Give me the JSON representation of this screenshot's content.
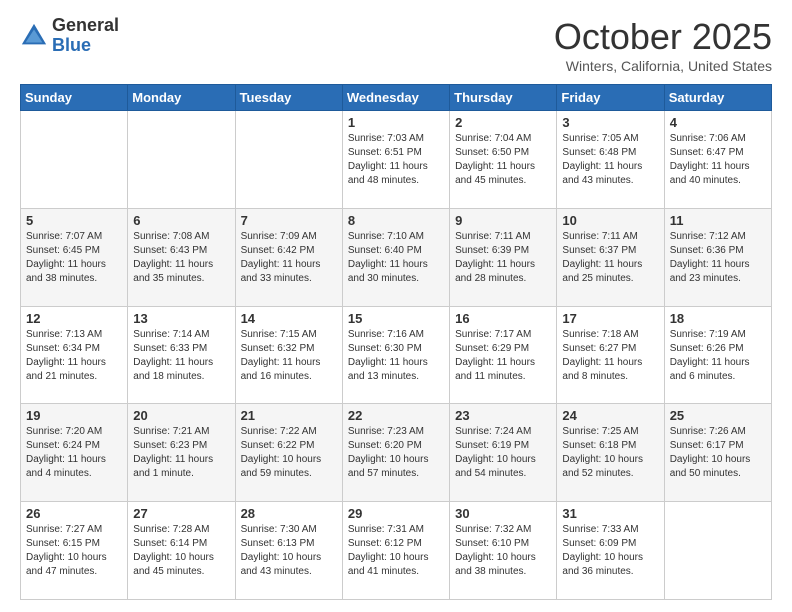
{
  "header": {
    "logo_general": "General",
    "logo_blue": "Blue",
    "month": "October 2025",
    "location": "Winters, California, United States"
  },
  "days_of_week": [
    "Sunday",
    "Monday",
    "Tuesday",
    "Wednesday",
    "Thursday",
    "Friday",
    "Saturday"
  ],
  "weeks": [
    [
      {
        "day": "",
        "info": ""
      },
      {
        "day": "",
        "info": ""
      },
      {
        "day": "",
        "info": ""
      },
      {
        "day": "1",
        "info": "Sunrise: 7:03 AM\nSunset: 6:51 PM\nDaylight: 11 hours and 48 minutes."
      },
      {
        "day": "2",
        "info": "Sunrise: 7:04 AM\nSunset: 6:50 PM\nDaylight: 11 hours and 45 minutes."
      },
      {
        "day": "3",
        "info": "Sunrise: 7:05 AM\nSunset: 6:48 PM\nDaylight: 11 hours and 43 minutes."
      },
      {
        "day": "4",
        "info": "Sunrise: 7:06 AM\nSunset: 6:47 PM\nDaylight: 11 hours and 40 minutes."
      }
    ],
    [
      {
        "day": "5",
        "info": "Sunrise: 7:07 AM\nSunset: 6:45 PM\nDaylight: 11 hours and 38 minutes."
      },
      {
        "day": "6",
        "info": "Sunrise: 7:08 AM\nSunset: 6:43 PM\nDaylight: 11 hours and 35 minutes."
      },
      {
        "day": "7",
        "info": "Sunrise: 7:09 AM\nSunset: 6:42 PM\nDaylight: 11 hours and 33 minutes."
      },
      {
        "day": "8",
        "info": "Sunrise: 7:10 AM\nSunset: 6:40 PM\nDaylight: 11 hours and 30 minutes."
      },
      {
        "day": "9",
        "info": "Sunrise: 7:11 AM\nSunset: 6:39 PM\nDaylight: 11 hours and 28 minutes."
      },
      {
        "day": "10",
        "info": "Sunrise: 7:11 AM\nSunset: 6:37 PM\nDaylight: 11 hours and 25 minutes."
      },
      {
        "day": "11",
        "info": "Sunrise: 7:12 AM\nSunset: 6:36 PM\nDaylight: 11 hours and 23 minutes."
      }
    ],
    [
      {
        "day": "12",
        "info": "Sunrise: 7:13 AM\nSunset: 6:34 PM\nDaylight: 11 hours and 21 minutes."
      },
      {
        "day": "13",
        "info": "Sunrise: 7:14 AM\nSunset: 6:33 PM\nDaylight: 11 hours and 18 minutes."
      },
      {
        "day": "14",
        "info": "Sunrise: 7:15 AM\nSunset: 6:32 PM\nDaylight: 11 hours and 16 minutes."
      },
      {
        "day": "15",
        "info": "Sunrise: 7:16 AM\nSunset: 6:30 PM\nDaylight: 11 hours and 13 minutes."
      },
      {
        "day": "16",
        "info": "Sunrise: 7:17 AM\nSunset: 6:29 PM\nDaylight: 11 hours and 11 minutes."
      },
      {
        "day": "17",
        "info": "Sunrise: 7:18 AM\nSunset: 6:27 PM\nDaylight: 11 hours and 8 minutes."
      },
      {
        "day": "18",
        "info": "Sunrise: 7:19 AM\nSunset: 6:26 PM\nDaylight: 11 hours and 6 minutes."
      }
    ],
    [
      {
        "day": "19",
        "info": "Sunrise: 7:20 AM\nSunset: 6:24 PM\nDaylight: 11 hours and 4 minutes."
      },
      {
        "day": "20",
        "info": "Sunrise: 7:21 AM\nSunset: 6:23 PM\nDaylight: 11 hours and 1 minute."
      },
      {
        "day": "21",
        "info": "Sunrise: 7:22 AM\nSunset: 6:22 PM\nDaylight: 10 hours and 59 minutes."
      },
      {
        "day": "22",
        "info": "Sunrise: 7:23 AM\nSunset: 6:20 PM\nDaylight: 10 hours and 57 minutes."
      },
      {
        "day": "23",
        "info": "Sunrise: 7:24 AM\nSunset: 6:19 PM\nDaylight: 10 hours and 54 minutes."
      },
      {
        "day": "24",
        "info": "Sunrise: 7:25 AM\nSunset: 6:18 PM\nDaylight: 10 hours and 52 minutes."
      },
      {
        "day": "25",
        "info": "Sunrise: 7:26 AM\nSunset: 6:17 PM\nDaylight: 10 hours and 50 minutes."
      }
    ],
    [
      {
        "day": "26",
        "info": "Sunrise: 7:27 AM\nSunset: 6:15 PM\nDaylight: 10 hours and 47 minutes."
      },
      {
        "day": "27",
        "info": "Sunrise: 7:28 AM\nSunset: 6:14 PM\nDaylight: 10 hours and 45 minutes."
      },
      {
        "day": "28",
        "info": "Sunrise: 7:30 AM\nSunset: 6:13 PM\nDaylight: 10 hours and 43 minutes."
      },
      {
        "day": "29",
        "info": "Sunrise: 7:31 AM\nSunset: 6:12 PM\nDaylight: 10 hours and 41 minutes."
      },
      {
        "day": "30",
        "info": "Sunrise: 7:32 AM\nSunset: 6:10 PM\nDaylight: 10 hours and 38 minutes."
      },
      {
        "day": "31",
        "info": "Sunrise: 7:33 AM\nSunset: 6:09 PM\nDaylight: 10 hours and 36 minutes."
      },
      {
        "day": "",
        "info": ""
      }
    ]
  ]
}
